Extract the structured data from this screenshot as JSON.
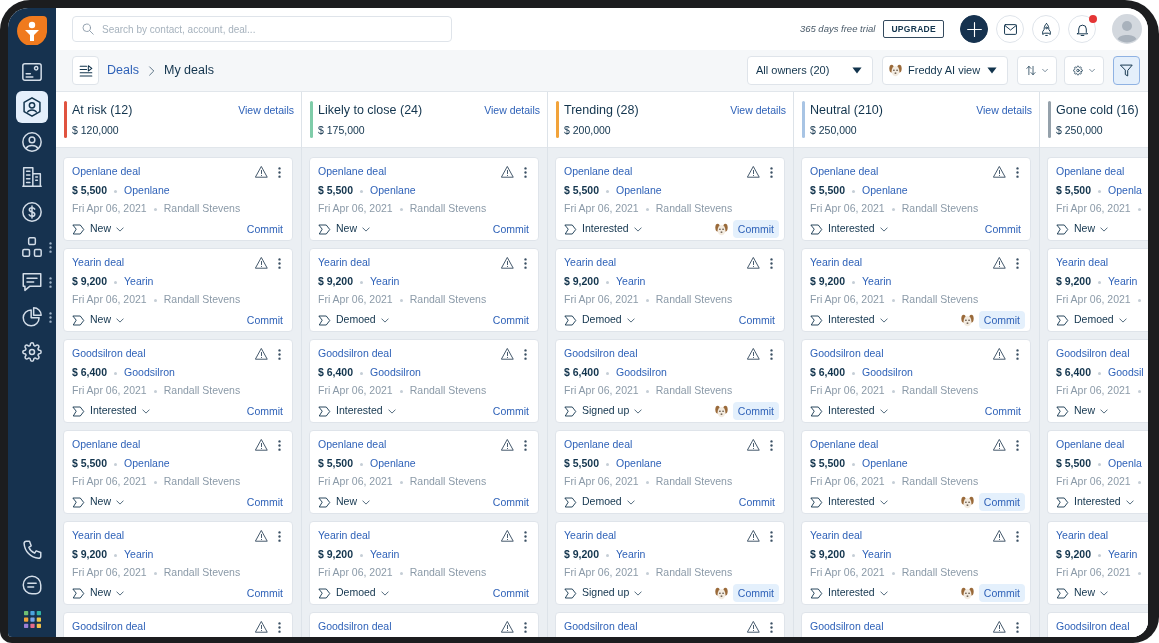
{
  "sidebar": {
    "items": [
      {
        "selected": false,
        "submenu": false
      },
      {
        "selected": true,
        "submenu": false
      },
      {
        "selected": false,
        "submenu": false
      },
      {
        "selected": false,
        "submenu": false
      },
      {
        "selected": false,
        "submenu": false
      },
      {
        "selected": false,
        "submenu": true
      },
      {
        "selected": false,
        "submenu": true
      },
      {
        "selected": false,
        "submenu": true
      },
      {
        "selected": false,
        "submenu": false
      }
    ],
    "bottom_items": [
      {
        "selected": false
      },
      {
        "selected": false
      },
      {
        "selected": false
      }
    ]
  },
  "topbar": {
    "search": {
      "placeholder": "Search by contact, account, deal..."
    },
    "trial_text": "365 days free trial",
    "upgrade_button": "UPGRADE",
    "notifications": {
      "unread": true
    }
  },
  "toolbar": {
    "breadcrumb": [
      "Deals",
      "My deals"
    ],
    "owner_filter": "All owners (20)",
    "view_filter": "Freddy AI view",
    "filter_active": true
  },
  "columns": [
    {
      "title": "At risk (12)",
      "total": "$ 120,000",
      "link": "View details",
      "color": "#e0533f",
      "cards": [
        {
          "title": "Openlane deal",
          "amount": "$ 5,500",
          "account": "Openlane",
          "date": "Fri Apr 06, 2021",
          "owner": "Randall Stevens",
          "stage": "New",
          "commit": "Commit",
          "ai_suggested": false
        },
        {
          "title": "Yearin deal",
          "amount": "$ 9,200",
          "account": "Yearin",
          "date": "Fri Apr 06, 2021",
          "owner": "Randall Stevens",
          "stage": "New",
          "commit": "Commit",
          "ai_suggested": false
        },
        {
          "title": "Goodsilron deal",
          "amount": "$ 6,400",
          "account": "Goodsilron",
          "date": "Fri Apr 06, 2021",
          "owner": "Randall Stevens",
          "stage": "Interested",
          "commit": "Commit",
          "ai_suggested": false
        },
        {
          "title": "Openlane deal",
          "amount": "$ 5,500",
          "account": "Openlane",
          "date": "Fri Apr 06, 2021",
          "owner": "Randall Stevens",
          "stage": "New",
          "commit": "Commit",
          "ai_suggested": false
        },
        {
          "title": "Yearin deal",
          "amount": "$ 9,200",
          "account": "Yearin",
          "date": "Fri Apr 06, 2021",
          "owner": "Randall Stevens",
          "stage": "New",
          "commit": "Commit",
          "ai_suggested": false
        },
        {
          "title": "Goodsilron deal"
        }
      ]
    },
    {
      "title": "Likely to close (24)",
      "total": "$ 175,000",
      "link": "View details",
      "color": "#7fcca9",
      "cards": [
        {
          "title": "Openlane deal",
          "amount": "$ 5,500",
          "account": "Openlane",
          "date": "Fri Apr 06, 2021",
          "owner": "Randall Stevens",
          "stage": "New",
          "commit": "Commit",
          "ai_suggested": false
        },
        {
          "title": "Yearin deal",
          "amount": "$ 9,200",
          "account": "Yearin",
          "date": "Fri Apr 06, 2021",
          "owner": "Randall Stevens",
          "stage": "Demoed",
          "commit": "Commit",
          "ai_suggested": false
        },
        {
          "title": "Goodsilron deal",
          "amount": "$ 6,400",
          "account": "Goodsilron",
          "date": "Fri Apr 06, 2021",
          "owner": "Randall Stevens",
          "stage": "Interested",
          "commit": "Commit",
          "ai_suggested": false
        },
        {
          "title": "Openlane deal",
          "amount": "$ 5,500",
          "account": "Openlane",
          "date": "Fri Apr 06, 2021",
          "owner": "Randall Stevens",
          "stage": "New",
          "commit": "Commit",
          "ai_suggested": false
        },
        {
          "title": "Yearin deal",
          "amount": "$ 9,200",
          "account": "Yearin",
          "date": "Fri Apr 06, 2021",
          "owner": "Randall Stevens",
          "stage": "Demoed",
          "commit": "Commit",
          "ai_suggested": false
        },
        {
          "title": "Goodsilron deal"
        }
      ]
    },
    {
      "title": "Trending (28)",
      "total": "$ 200,000",
      "link": "View details",
      "color": "#f2a33a",
      "cards": [
        {
          "title": "Openlane deal",
          "amount": "$ 5,500",
          "account": "Openlane",
          "date": "Fri Apr 06, 2021",
          "owner": "Randall Stevens",
          "stage": "Interested",
          "commit": "Commit",
          "ai_suggested": true
        },
        {
          "title": "Yearin deal",
          "amount": "$ 9,200",
          "account": "Yearin",
          "date": "Fri Apr 06, 2021",
          "owner": "Randall Stevens",
          "stage": "Demoed",
          "commit": "Commit",
          "ai_suggested": false
        },
        {
          "title": "Goodsilron deal",
          "amount": "$ 6,400",
          "account": "Goodsilron",
          "date": "Fri Apr 06, 2021",
          "owner": "Randall Stevens",
          "stage": "Signed up",
          "commit": "Commit",
          "ai_suggested": true
        },
        {
          "title": "Openlane deal",
          "amount": "$ 5,500",
          "account": "Openlane",
          "date": "Fri Apr 06, 2021",
          "owner": "Randall Stevens",
          "stage": "Demoed",
          "commit": "Commit",
          "ai_suggested": false
        },
        {
          "title": "Yearin deal",
          "amount": "$ 9,200",
          "account": "Yearin",
          "date": "Fri Apr 06, 2021",
          "owner": "Randall Stevens",
          "stage": "Signed up",
          "commit": "Commit",
          "ai_suggested": true
        },
        {
          "title": "Goodsilron deal"
        }
      ]
    },
    {
      "title": "Neutral (210)",
      "total": "$ 250,000",
      "link": "View details",
      "color": "#a8c4e4",
      "cards": [
        {
          "title": "Openlane deal",
          "amount": "$ 5,500",
          "account": "Openlane",
          "date": "Fri Apr 06, 2021",
          "owner": "Randall Stevens",
          "stage": "Interested",
          "commit": "Commit",
          "ai_suggested": false
        },
        {
          "title": "Yearin deal",
          "amount": "$ 9,200",
          "account": "Yearin",
          "date": "Fri Apr 06, 2021",
          "owner": "Randall Stevens",
          "stage": "Interested",
          "commit": "Commit",
          "ai_suggested": true
        },
        {
          "title": "Goodsilron deal",
          "amount": "$ 6,400",
          "account": "Goodsilron",
          "date": "Fri Apr 06, 2021",
          "owner": "Randall Stevens",
          "stage": "Interested",
          "commit": "Commit",
          "ai_suggested": false
        },
        {
          "title": "Openlane deal",
          "amount": "$ 5,500",
          "account": "Openlane",
          "date": "Fri Apr 06, 2021",
          "owner": "Randall Stevens",
          "stage": "Interested",
          "commit": "Commit",
          "ai_suggested": true
        },
        {
          "title": "Yearin deal",
          "amount": "$ 9,200",
          "account": "Yearin",
          "date": "Fri Apr 06, 2021",
          "owner": "Randall Stevens",
          "stage": "Interested",
          "commit": "Commit",
          "ai_suggested": true
        },
        {
          "title": "Goodsilron deal"
        }
      ]
    },
    {
      "title": "Gone cold (16)",
      "total": "$ 250,000",
      "color": "#95a1ab",
      "clipped": true,
      "cards": [
        {
          "title": "Openlane deal",
          "amount": "$ 5,500",
          "account": "Openla",
          "date": "Fri Apr 06, 2021",
          "stage": "New"
        },
        {
          "title": "Yearin deal",
          "amount": "$ 9,200",
          "account": "Yearin",
          "date": "Fri Apr 06, 2021",
          "stage": "Demoed"
        },
        {
          "title": "Goodsilron deal",
          "amount": "$ 6,400",
          "account": "Goodsil",
          "date": "Fri Apr 06, 2021",
          "stage": "New"
        },
        {
          "title": "Openlane deal",
          "amount": "$ 5,500",
          "account": "Openla",
          "date": "Fri Apr 06, 2021",
          "stage": "Interested"
        },
        {
          "title": "Yearin deal",
          "amount": "$ 9,200",
          "account": "Yearin",
          "date": "Fri Apr 06, 2021",
          "stage": "New"
        },
        {
          "title": "Goodsilron deal"
        }
      ]
    }
  ]
}
